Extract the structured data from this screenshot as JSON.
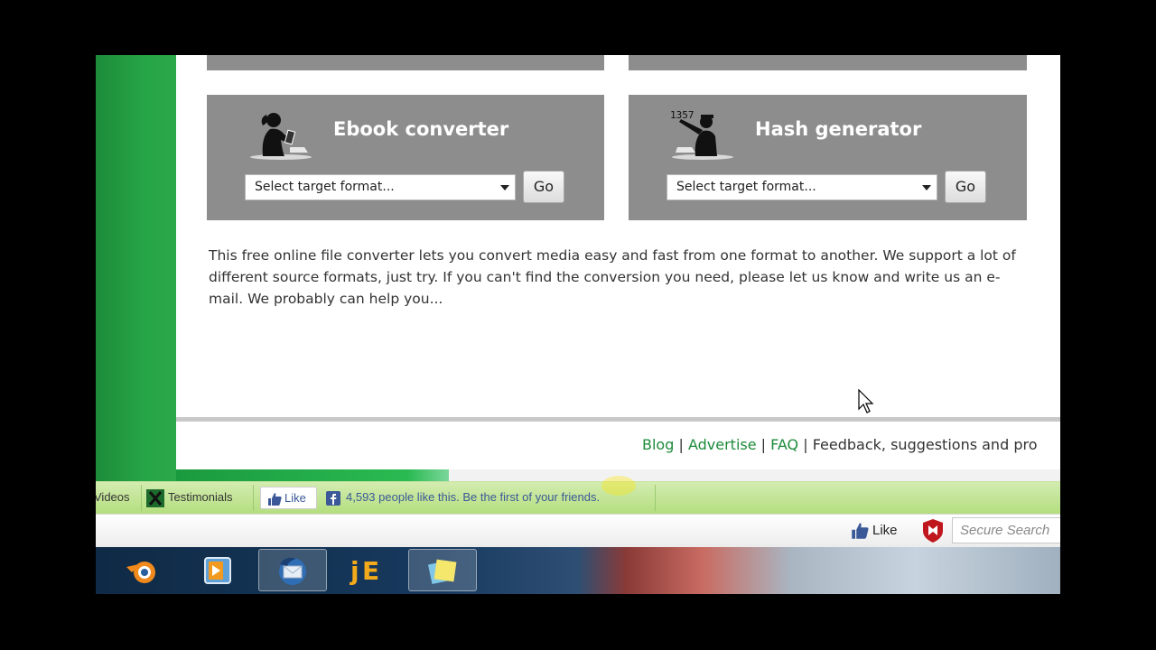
{
  "cards": {
    "ebook": {
      "title": "Ebook converter",
      "select_placeholder": "Select target format...",
      "go_label": "Go"
    },
    "hash": {
      "title": "Hash generator",
      "select_placeholder": "Select target format...",
      "go_label": "Go",
      "figure_text": "1357"
    }
  },
  "intro_text": "This free online file converter lets you convert media easy and fast from one format to another. We support a lot of different source formats, just try. If you can't find the conversion you need, please let us know and write us an e-mail. We probably can help you...",
  "footer": {
    "links": [
      "Blog",
      "Advertise",
      "FAQ"
    ],
    "separator": "|",
    "trailing_text": "Feedback, suggestions and pro"
  },
  "addon_bar": {
    "videos_label": "Videos",
    "testimonials_label": "Testimonials",
    "like_label": "Like",
    "like_count_text": "4,593 people like this. Be the first of your friends."
  },
  "nav_bar": {
    "like_label": "Like",
    "search_placeholder": "Secure Search"
  },
  "colors": {
    "brand_green": "#1d8b3a",
    "card_gray": "#8d8d8d",
    "addon_bar_green": "#b4de7f",
    "facebook_blue": "#3b5998",
    "mcafee_red": "#c0161d"
  },
  "icons": [
    "ebook-reader-figure-icon",
    "hash-figure-icon",
    "select-arrow-icon",
    "testimonials-icon",
    "facebook-like-icon",
    "facebook-logo-icon",
    "mcafee-shield-icon",
    "blender-icon",
    "media-player-icon",
    "thunderbird-icon",
    "jedit-icon",
    "sticky-notes-icon",
    "mouse-pointer-icon"
  ]
}
